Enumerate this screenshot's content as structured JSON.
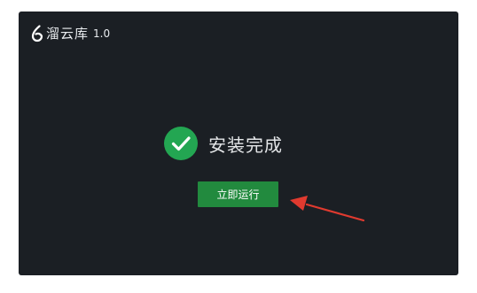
{
  "window": {
    "app_name": "溜云库",
    "version": "1.0",
    "logo_icon": "drop-swirl-logo",
    "background_color": "#1b1f24"
  },
  "status": {
    "icon": "check-circle-icon",
    "icon_color": "#23a652",
    "text": "安装完成"
  },
  "actions": {
    "run_now_label": "立即运行",
    "button_color": "#228a3e"
  },
  "annotation": {
    "arrow_color": "#e03a2f"
  }
}
